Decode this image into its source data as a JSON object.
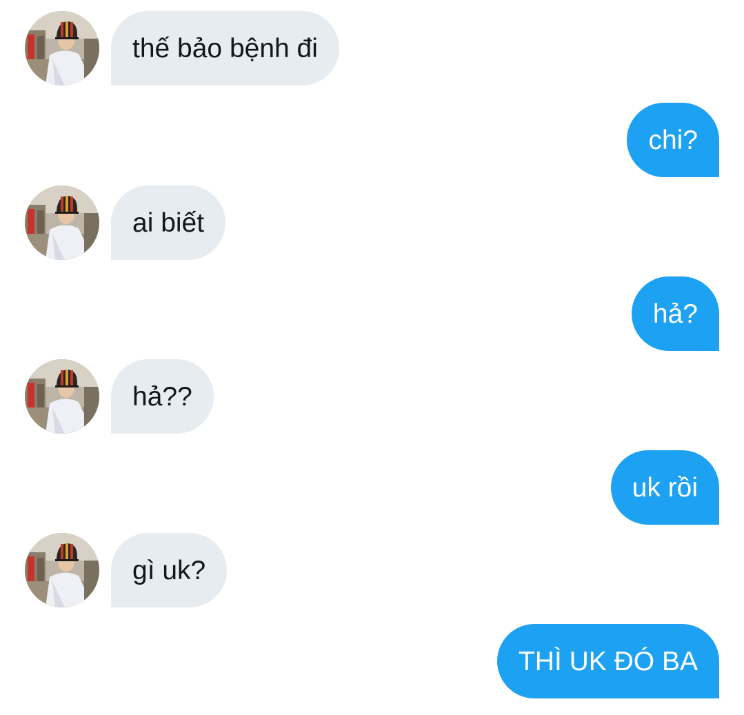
{
  "conversation": {
    "messages": [
      {
        "direction": "in",
        "text": "thế bảo bệnh đi"
      },
      {
        "direction": "out",
        "text": "chi?"
      },
      {
        "direction": "in",
        "text": "ai biết"
      },
      {
        "direction": "out",
        "text": "hả?"
      },
      {
        "direction": "in",
        "text": "hả??"
      },
      {
        "direction": "out",
        "text": "uk rồi"
      },
      {
        "direction": "in",
        "text": "gì uk?"
      },
      {
        "direction": "out",
        "text": "THÌ UK ĐÓ BA"
      }
    ]
  },
  "colors": {
    "incoming_bubble": "#e6ecf0",
    "incoming_text": "#14171a",
    "outgoing_bubble": "#1da1f2",
    "outgoing_text": "#ffffff"
  },
  "icons": {
    "avatar": "contact-avatar-photo"
  }
}
